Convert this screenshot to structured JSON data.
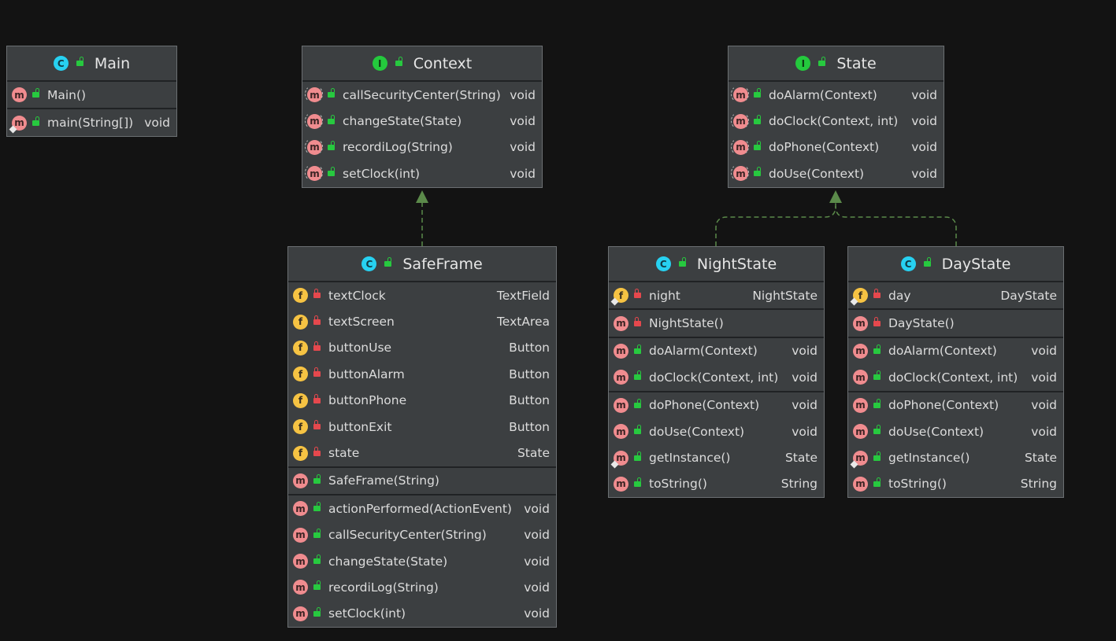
{
  "classes": {
    "main": {
      "name": "Main",
      "kind": "class",
      "constructors": [
        {
          "name": "Main()",
          "type": ""
        }
      ],
      "methods": [
        {
          "name": "main(String[])",
          "type": "void",
          "static": true
        }
      ]
    },
    "context": {
      "name": "Context",
      "kind": "interface",
      "methods": [
        {
          "name": "callSecurityCenter(String)",
          "type": "void"
        },
        {
          "name": "changeState(State)",
          "type": "void"
        },
        {
          "name": "recordiLog(String)",
          "type": "void"
        },
        {
          "name": "setClock(int)",
          "type": "void"
        }
      ]
    },
    "state": {
      "name": "State",
      "kind": "interface",
      "methods": [
        {
          "name": "doAlarm(Context)",
          "type": "void"
        },
        {
          "name": "doClock(Context, int)",
          "type": "void"
        },
        {
          "name": "doPhone(Context)",
          "type": "void"
        },
        {
          "name": "doUse(Context)",
          "type": "void"
        }
      ]
    },
    "safeframe": {
      "name": "SafeFrame",
      "kind": "class",
      "fields": [
        {
          "name": "textClock",
          "type": "TextField"
        },
        {
          "name": "textScreen",
          "type": "TextArea"
        },
        {
          "name": "buttonUse",
          "type": "Button"
        },
        {
          "name": "buttonAlarm",
          "type": "Button"
        },
        {
          "name": "buttonPhone",
          "type": "Button"
        },
        {
          "name": "buttonExit",
          "type": "Button"
        },
        {
          "name": "state",
          "type": "State"
        }
      ],
      "constructors": [
        {
          "name": "SafeFrame(String)",
          "type": ""
        }
      ],
      "methods": [
        {
          "name": "actionPerformed(ActionEvent)",
          "type": "void"
        },
        {
          "name": "callSecurityCenter(String)",
          "type": "void"
        },
        {
          "name": "changeState(State)",
          "type": "void"
        },
        {
          "name": "recordiLog(String)",
          "type": "void"
        },
        {
          "name": "setClock(int)",
          "type": "void"
        }
      ]
    },
    "nightstate": {
      "name": "NightState",
      "kind": "class",
      "fields": [
        {
          "name": "night",
          "type": "NightState",
          "static": true
        }
      ],
      "constructors": [
        {
          "name": "NightState()",
          "type": ""
        }
      ],
      "methods_a": [
        {
          "name": "doAlarm(Context)",
          "type": "void"
        },
        {
          "name": "doClock(Context, int)",
          "type": "void"
        }
      ],
      "methods_b": [
        {
          "name": "doPhone(Context)",
          "type": "void"
        },
        {
          "name": "doUse(Context)",
          "type": "void"
        },
        {
          "name": "getInstance()",
          "type": "State",
          "static": true
        },
        {
          "name": "toString()",
          "type": "String"
        }
      ]
    },
    "daystate": {
      "name": "DayState",
      "kind": "class",
      "fields": [
        {
          "name": "day",
          "type": "DayState",
          "static": true
        }
      ],
      "constructors": [
        {
          "name": "DayState()",
          "type": ""
        }
      ],
      "methods_a": [
        {
          "name": "doAlarm(Context)",
          "type": "void"
        },
        {
          "name": "doClock(Context, int)",
          "type": "void"
        }
      ],
      "methods_b": [
        {
          "name": "doPhone(Context)",
          "type": "void"
        },
        {
          "name": "doUse(Context)",
          "type": "void"
        },
        {
          "name": "getInstance()",
          "type": "State",
          "static": true
        },
        {
          "name": "toString()",
          "type": "String"
        }
      ]
    }
  },
  "badges": {
    "class": "C",
    "interface": "I",
    "method": "m",
    "field": "f"
  },
  "colors": {
    "background": "#131313",
    "node": "#3c3f41",
    "edge": "#5b8a4a",
    "method_badge": "#f08c8f",
    "field_badge": "#f6c343",
    "class_badge": "#27d1f1",
    "interface_badge": "#24c93d",
    "public_lock": "#27c93f",
    "private_lock": "#e5484d"
  },
  "edges": [
    {
      "from": "SafeFrame",
      "to": "Context",
      "kind": "realization"
    },
    {
      "from": "NightState",
      "to": "State",
      "kind": "realization"
    },
    {
      "from": "DayState",
      "to": "State",
      "kind": "realization"
    }
  ]
}
